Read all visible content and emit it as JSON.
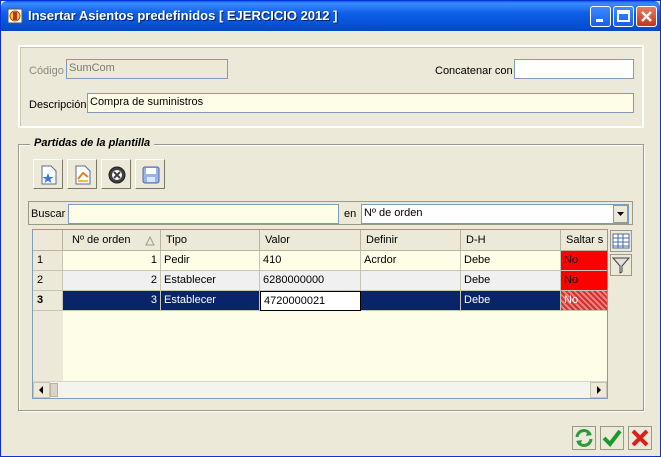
{
  "window": {
    "title": "Insertar Asientos predefinidos [ EJERCICIO 2012 ]"
  },
  "form": {
    "codigo_label": "Código",
    "codigo_value": "SumCom",
    "concatenar_label": "Concatenar con",
    "concatenar_value": "",
    "descripcion_label": "Descripción",
    "descripcion_value": "Compra de suministros"
  },
  "group": {
    "title": "Partidas de la plantilla"
  },
  "search": {
    "label": "Buscar",
    "value": "",
    "en_label": "en",
    "field_selected": "Nº de orden"
  },
  "table": {
    "columns": [
      "Nº de orden",
      "Tipo",
      "Valor",
      "Definir",
      "D-H",
      "Saltar s"
    ],
    "rows": [
      {
        "row": "1",
        "orden": "1",
        "tipo": "Pedir",
        "valor": "410",
        "definir": "Acrdor",
        "dh": "Debe",
        "saltar": "No"
      },
      {
        "row": "2",
        "orden": "2",
        "tipo": "Establecer",
        "valor": "6280000000",
        "definir": "",
        "dh": "Debe",
        "saltar": "No"
      },
      {
        "row": "3",
        "orden": "3",
        "tipo": "Establecer",
        "valor": "4720000021",
        "definir": "",
        "dh": "Debe",
        "saltar": "No"
      }
    ]
  },
  "colors": {
    "title_bar": "#0a5fe6",
    "selected_row": "#0a246a",
    "flag_red": "#ff0000"
  }
}
